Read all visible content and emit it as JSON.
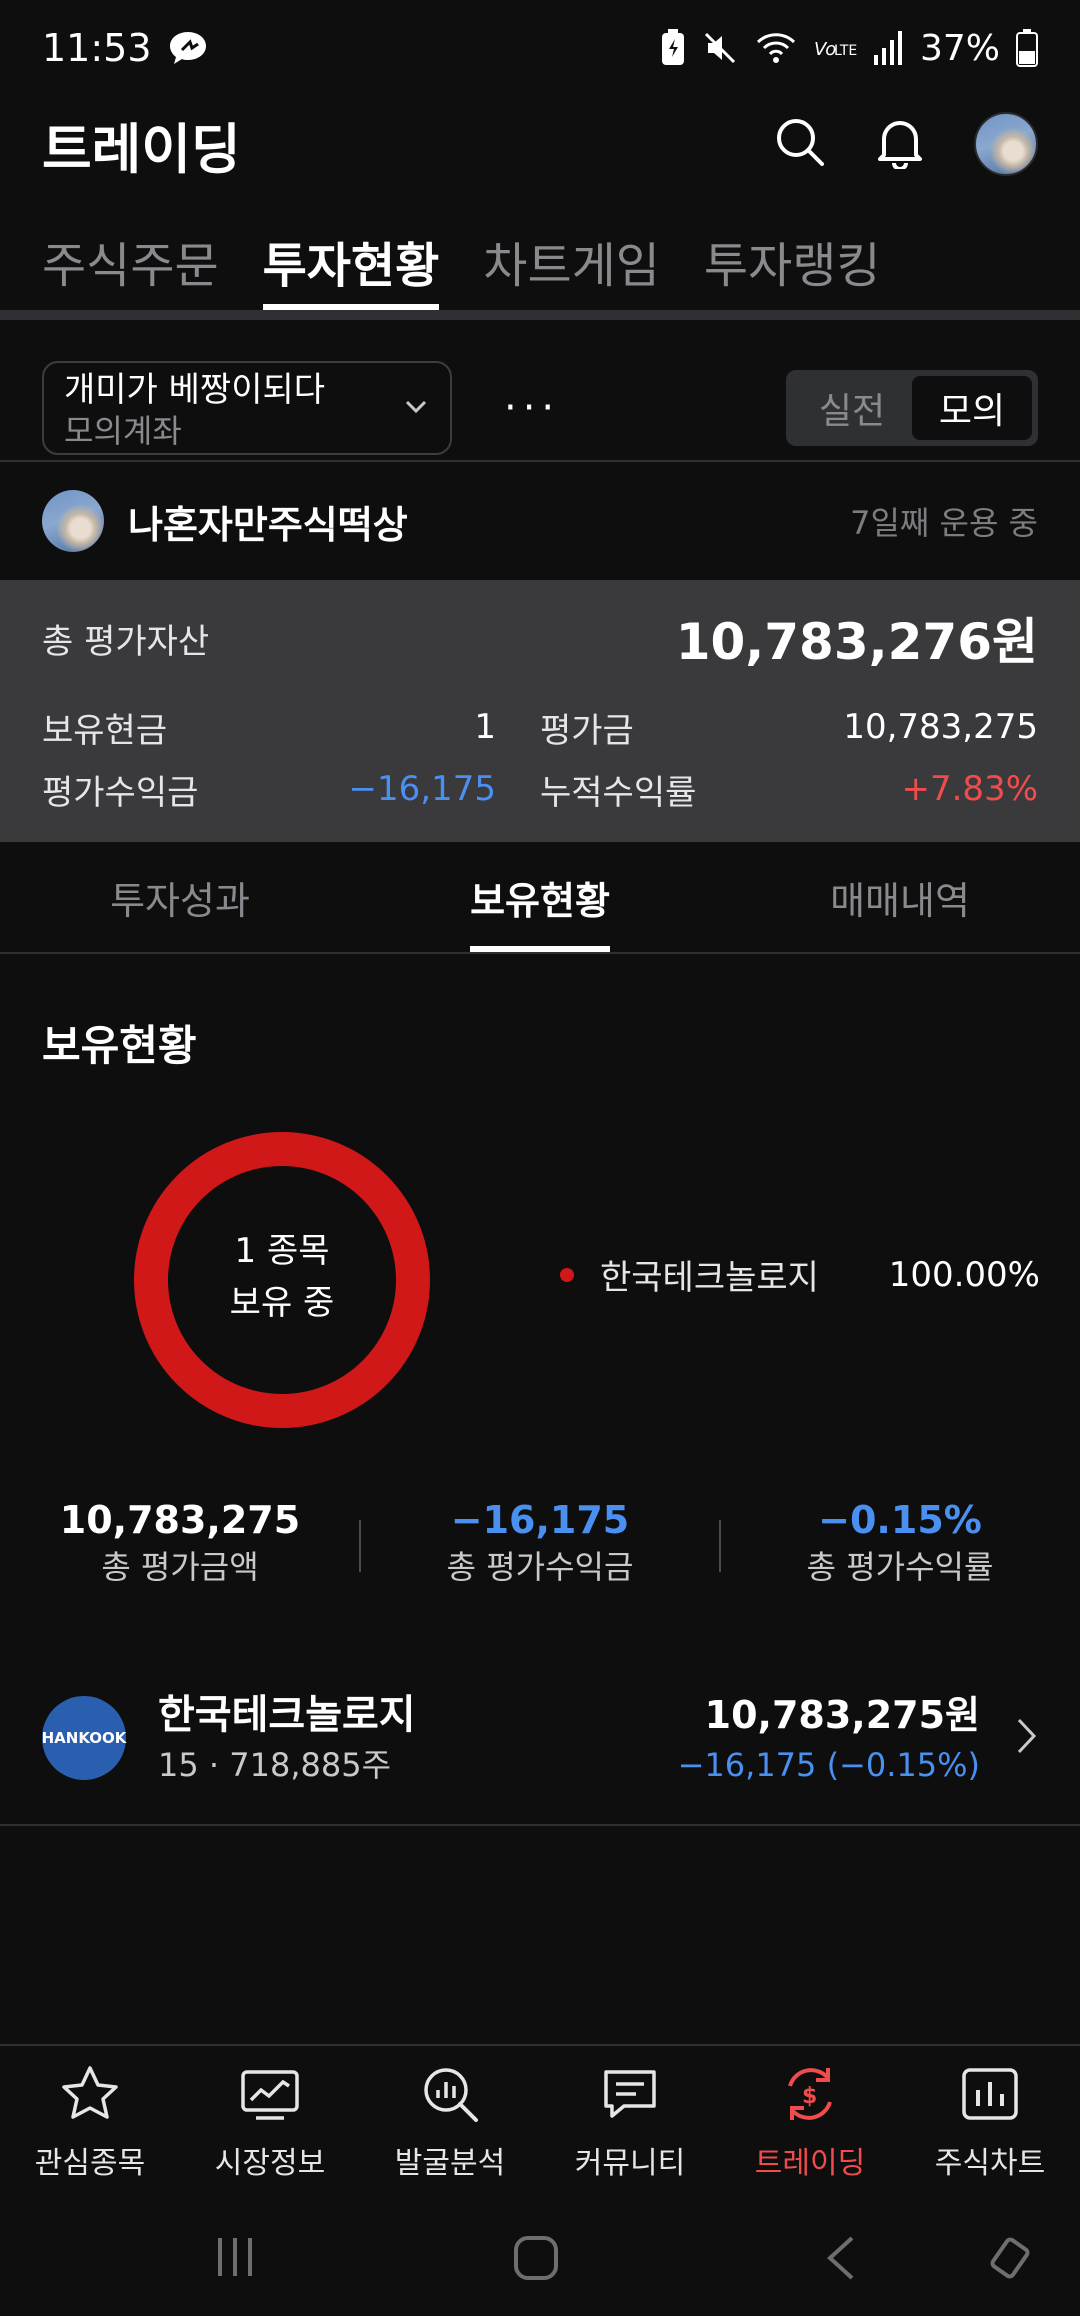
{
  "status_bar": {
    "time": "11:53",
    "battery": "37%"
  },
  "header": {
    "title": "트레이딩"
  },
  "top_tabs": [
    {
      "label": "주식주문",
      "active": false
    },
    {
      "label": "투자현황",
      "active": true
    },
    {
      "label": "차트게임",
      "active": false
    },
    {
      "label": "투자랭킹",
      "active": false
    }
  ],
  "account": {
    "name": "개미가 베짱이되다",
    "type": "모의계좌",
    "more": "···"
  },
  "mode_toggle": {
    "real": "실전",
    "mock": "모의",
    "selected": "모의"
  },
  "portfolio": {
    "name": "나혼자만주식떡상",
    "days": "7일째 운용 중"
  },
  "summary": {
    "total_label": "총 평가자산",
    "total_value": "10,783,276원",
    "cash_label": "보유현금",
    "cash_value": "1",
    "eval_label": "평가금",
    "eval_value": "10,783,275",
    "pnl_label": "평가수익금",
    "pnl_value": "−16,175",
    "cum_label": "누적수익률",
    "cum_value": "+7.83%"
  },
  "sub_tabs": [
    {
      "label": "투자성과",
      "active": false
    },
    {
      "label": "보유현황",
      "active": true
    },
    {
      "label": "매매내역",
      "active": false
    }
  ],
  "holdings_section": {
    "title": "보유현황",
    "donut_line1": "1 종목",
    "donut_line2": "보유 중",
    "legend": [
      {
        "name": "한국테크놀로지",
        "pct": "100.00%",
        "share": 100,
        "color": "#d01818"
      }
    ]
  },
  "totals": [
    {
      "value": "10,783,275",
      "label": "총 평가금액",
      "color": "#ffffff"
    },
    {
      "value": "−16,175",
      "label": "총 평가수익금",
      "color": "#4a90f0"
    },
    {
      "value": "−0.15%",
      "label": "총 평가수익률",
      "color": "#4a90f0"
    }
  ],
  "holding": {
    "logo_text": "HANKOOK",
    "name": "한국테크놀로지",
    "sub": "15 · 718,885주",
    "value": "10,783,275원",
    "change": "−16,175 (−0.15%)"
  },
  "bottom_nav": [
    {
      "label": "관심종목",
      "icon": "star-icon",
      "active": false
    },
    {
      "label": "시장정보",
      "icon": "chart-line-icon",
      "active": false
    },
    {
      "label": "발굴분석",
      "icon": "magnify-chart-icon",
      "active": false
    },
    {
      "label": "커뮤니티",
      "icon": "chat-icon",
      "active": false
    },
    {
      "label": "트레이딩",
      "icon": "trading-icon",
      "active": true
    },
    {
      "label": "주식차트",
      "icon": "bar-chart-icon",
      "active": false
    }
  ],
  "colors": {
    "accent_red": "#f04c4c",
    "blue": "#4a90f0",
    "donut_red": "#d01818"
  }
}
